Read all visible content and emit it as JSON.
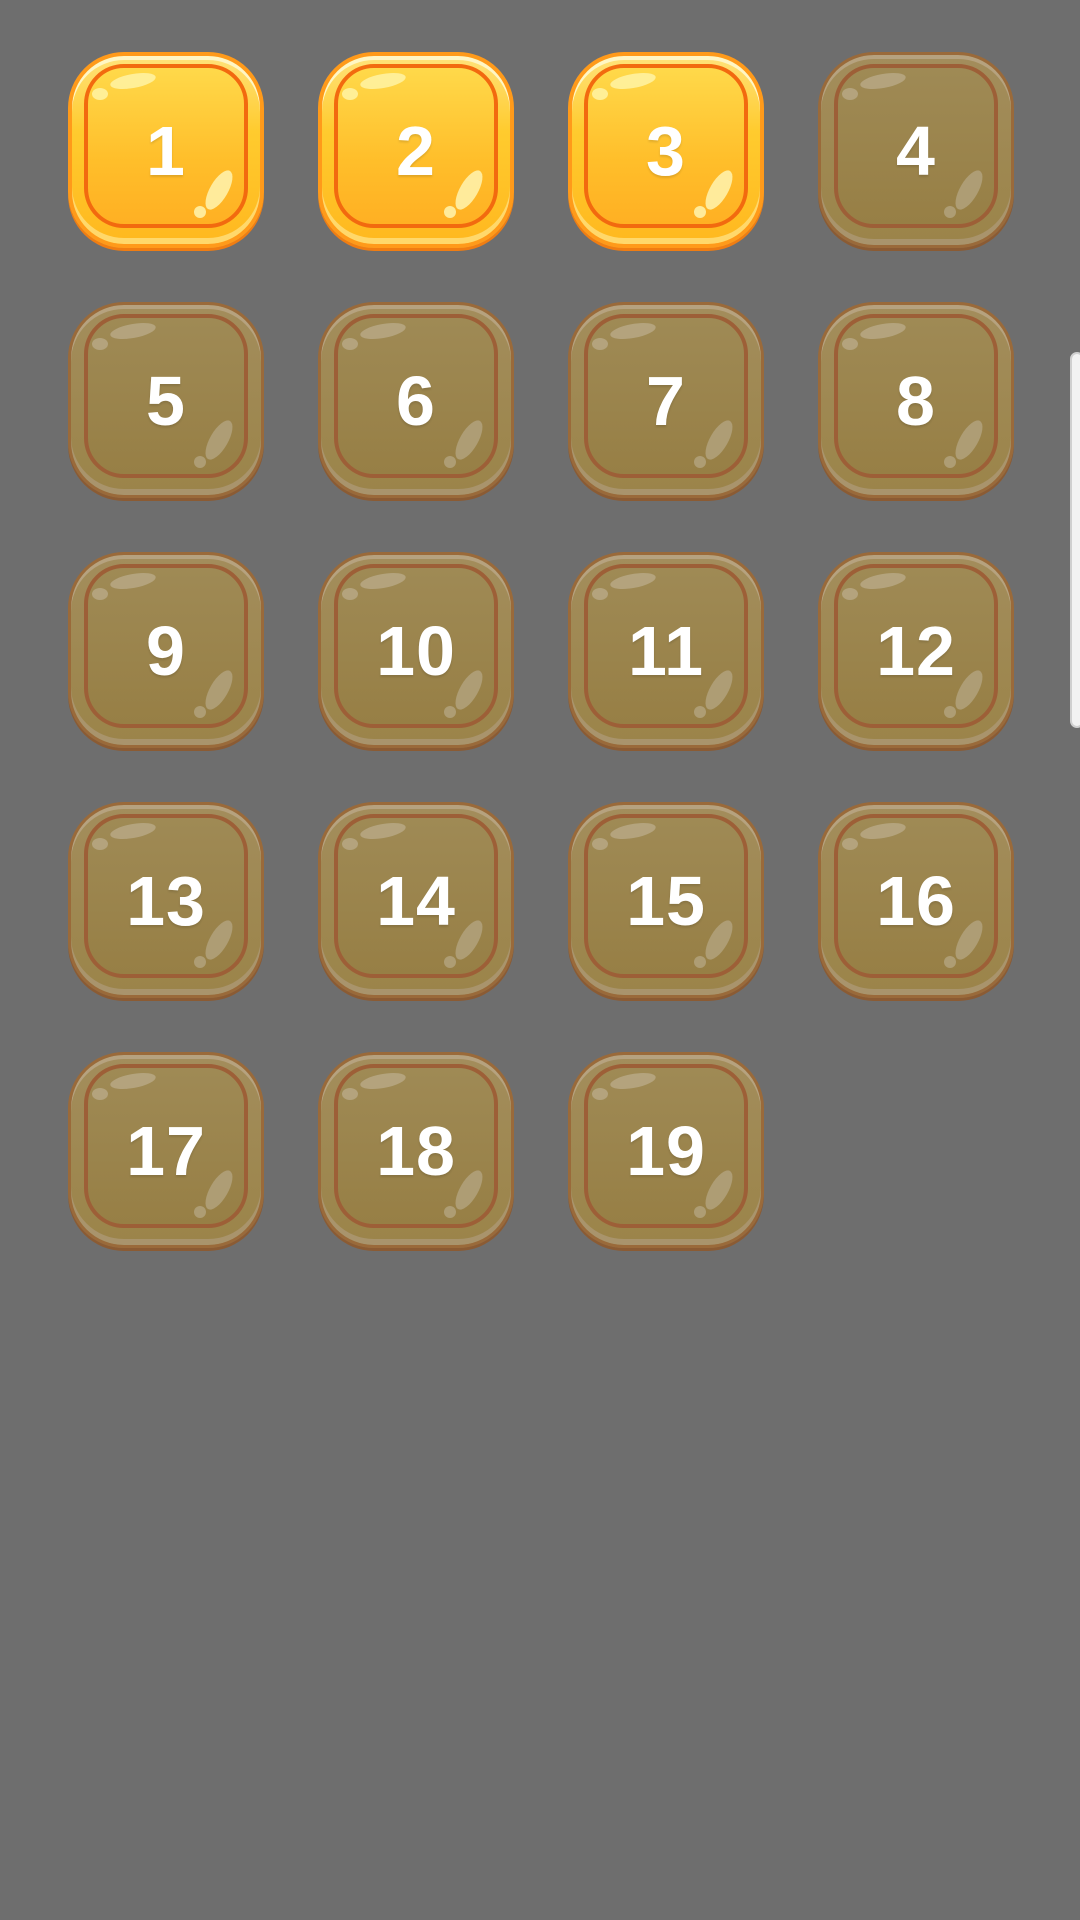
{
  "levels": [
    {
      "label": "1",
      "state": "unlocked"
    },
    {
      "label": "2",
      "state": "unlocked"
    },
    {
      "label": "3",
      "state": "unlocked"
    },
    {
      "label": "4",
      "state": "locked"
    },
    {
      "label": "5",
      "state": "locked"
    },
    {
      "label": "6",
      "state": "locked"
    },
    {
      "label": "7",
      "state": "locked"
    },
    {
      "label": "8",
      "state": "locked"
    },
    {
      "label": "9",
      "state": "locked"
    },
    {
      "label": "10",
      "state": "locked"
    },
    {
      "label": "11",
      "state": "locked"
    },
    {
      "label": "12",
      "state": "locked"
    },
    {
      "label": "13",
      "state": "locked"
    },
    {
      "label": "14",
      "state": "locked"
    },
    {
      "label": "15",
      "state": "locked"
    },
    {
      "label": "16",
      "state": "locked"
    },
    {
      "label": "17",
      "state": "locked"
    },
    {
      "label": "18",
      "state": "locked"
    },
    {
      "label": "19",
      "state": "locked"
    }
  ],
  "colors": {
    "background": "#6e6e6e",
    "unlocked_fill": "#ffbe2a",
    "unlocked_border": "#f26a0f",
    "locked_fill": "#9b8449",
    "locked_border": "#9d5f37",
    "label": "#ffffff"
  }
}
